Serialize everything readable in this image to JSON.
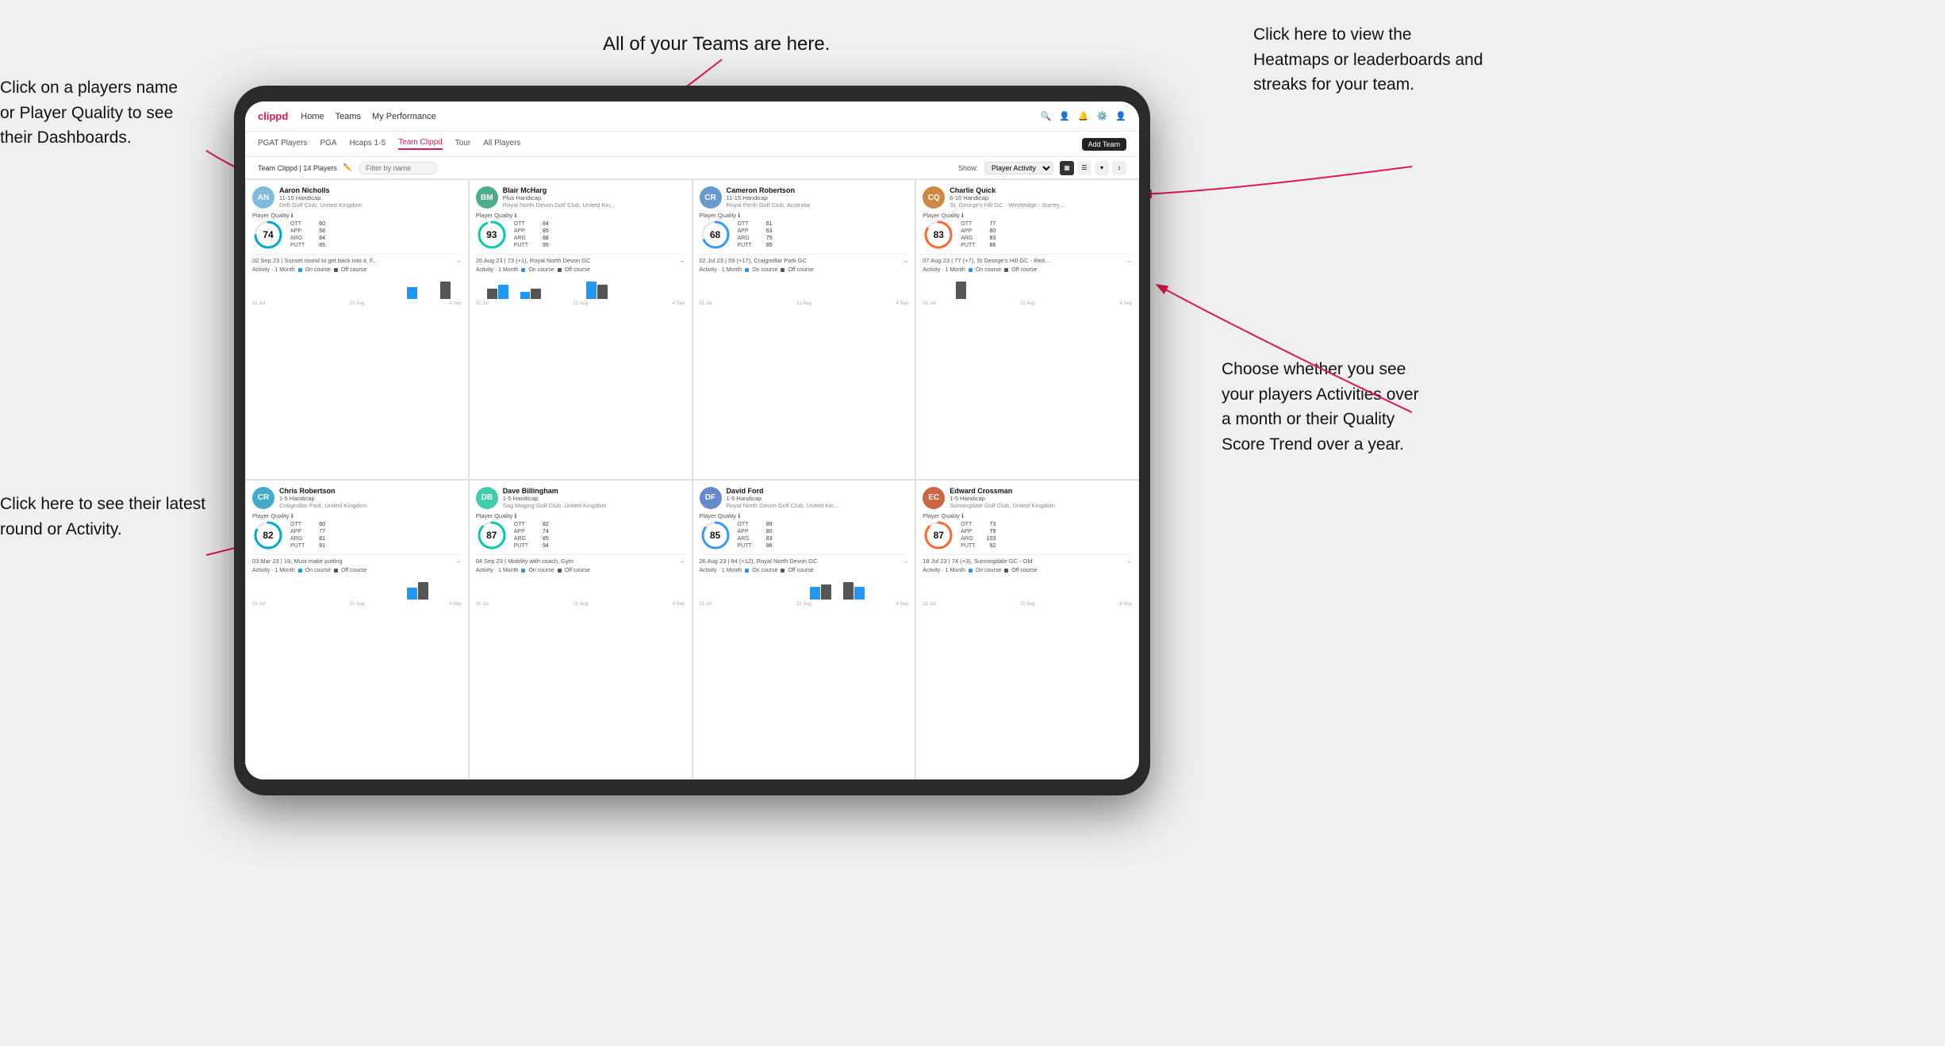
{
  "annotations": {
    "top_left": "Click on a players name\nor Player Quality to see\ntheir Dashboards.",
    "bottom_left": "Click here to see their latest\nround or Activity.",
    "top_center": "All of your Teams are here.",
    "top_right_1": "Click here to view the\nHeatmaps or leaderboards\nand streaks for your team.",
    "bottom_right": "Choose whether you see\nyour players Activities over\na month or their Quality\nScore Trend over a year."
  },
  "navbar": {
    "brand": "clippd",
    "items": [
      "Home",
      "Teams",
      "My Performance"
    ]
  },
  "tabs": {
    "items": [
      "PGAT Players",
      "PGA",
      "Hcaps 1-5",
      "Team Clippd",
      "Tour",
      "All Players"
    ],
    "active": "Team Clippd",
    "add_btn": "Add Team"
  },
  "toolbar": {
    "title": "Team Clippd | 14 Players",
    "filter_placeholder": "Filter by name",
    "show_label": "Show:",
    "show_value": "Player Activity"
  },
  "players": [
    {
      "name": "Aaron Nicholls",
      "handicap": "11-15 Handicap",
      "club": "Drift Golf Club, United Kingdom",
      "quality": 74,
      "color": "#00aacc",
      "stats": [
        {
          "label": "OTT",
          "color": "#f5a623",
          "val": 60,
          "pct": 60
        },
        {
          "label": "APP",
          "color": "#7ed321",
          "val": 58,
          "pct": 58
        },
        {
          "label": "ARG",
          "color": "#e0184d",
          "val": 84,
          "pct": 84
        },
        {
          "label": "PUTT",
          "color": "#9b59b6",
          "val": 85,
          "pct": 85
        }
      ],
      "round": "02 Sep 23 | Sunset round to get back into it, F...",
      "chart_bars": [
        0,
        0,
        0,
        0,
        0,
        0,
        0,
        0,
        0,
        0,
        0,
        0,
        0,
        0,
        2,
        0,
        0,
        3,
        0
      ],
      "chart_labels": [
        "31 Jul",
        "21 Aug",
        "4 Sep"
      ]
    },
    {
      "name": "Blair McHarg",
      "handicap": "Plus Handicap",
      "club": "Royal North Devon Golf Club, United Kin...",
      "quality": 93,
      "color": "#00ccaa",
      "stats": [
        {
          "label": "OTT",
          "color": "#f5a623",
          "val": 84,
          "pct": 84
        },
        {
          "label": "APP",
          "color": "#7ed321",
          "val": 85,
          "pct": 85
        },
        {
          "label": "ARG",
          "color": "#e0184d",
          "val": 88,
          "pct": 88
        },
        {
          "label": "PUTT",
          "color": "#9b59b6",
          "val": 95,
          "pct": 95
        }
      ],
      "round": "26 Aug 23 | 73 (+1), Royal North Devon GC",
      "chart_bars": [
        0,
        3,
        4,
        0,
        2,
        3,
        0,
        0,
        0,
        0,
        5,
        4,
        0,
        0,
        0,
        0,
        0,
        0,
        0
      ],
      "chart_labels": [
        "31 Jul",
        "21 Aug",
        "4 Sep"
      ]
    },
    {
      "name": "Cameron Robertson",
      "handicap": "11-15 Handicap",
      "club": "Royal Perth Golf Club, Australia",
      "quality": 68,
      "color": "#3399ff",
      "stats": [
        {
          "label": "OTT",
          "color": "#f5a623",
          "val": 61,
          "pct": 61
        },
        {
          "label": "APP",
          "color": "#7ed321",
          "val": 63,
          "pct": 63
        },
        {
          "label": "ARG",
          "color": "#e0184d",
          "val": 75,
          "pct": 75
        },
        {
          "label": "PUTT",
          "color": "#9b59b6",
          "val": 85,
          "pct": 85
        }
      ],
      "round": "02 Jul 23 | 59 (+17), Craigmillar Park GC",
      "chart_bars": [
        0,
        0,
        0,
        0,
        0,
        0,
        0,
        0,
        0,
        0,
        0,
        0,
        0,
        0,
        0,
        0,
        0,
        0,
        0
      ],
      "chart_labels": [
        "31 Jul",
        "21 Aug",
        "4 Sep"
      ]
    },
    {
      "name": "Charlie Quick",
      "handicap": "6-10 Handicap",
      "club": "St. George's Hill GC - Weybridge - Surrey...",
      "quality": 83,
      "color": "#ff6633",
      "stats": [
        {
          "label": "OTT",
          "color": "#f5a623",
          "val": 77,
          "pct": 77
        },
        {
          "label": "APP",
          "color": "#7ed321",
          "val": 80,
          "pct": 80
        },
        {
          "label": "ARG",
          "color": "#e0184d",
          "val": 83,
          "pct": 83
        },
        {
          "label": "PUTT",
          "color": "#9b59b6",
          "val": 86,
          "pct": 86
        }
      ],
      "round": "07 Aug 23 | 77 (+7), St George's Hill GC - Red...",
      "chart_bars": [
        0,
        0,
        0,
        2,
        0,
        0,
        0,
        0,
        0,
        0,
        0,
        0,
        0,
        0,
        0,
        0,
        0,
        0,
        0
      ],
      "chart_labels": [
        "31 Jul",
        "21 Aug",
        "4 Sep"
      ]
    },
    {
      "name": "Chris Robertson",
      "handicap": "1-5 Handicap",
      "club": "Craigmillar Park, United Kingdom",
      "quality": 82,
      "color": "#00aacc",
      "stats": [
        {
          "label": "OTT",
          "color": "#f5a623",
          "val": 60,
          "pct": 60
        },
        {
          "label": "APP",
          "color": "#7ed321",
          "val": 77,
          "pct": 77
        },
        {
          "label": "ARG",
          "color": "#e0184d",
          "val": 81,
          "pct": 81
        },
        {
          "label": "PUTT",
          "color": "#9b59b6",
          "val": 91,
          "pct": 91
        }
      ],
      "round": "03 Mar 23 | 19, Must make putting",
      "chart_bars": [
        0,
        0,
        0,
        0,
        0,
        0,
        0,
        0,
        0,
        0,
        0,
        0,
        0,
        0,
        2,
        3,
        0,
        0,
        0
      ],
      "chart_labels": [
        "31 Jul",
        "21 Aug",
        "4 Sep"
      ]
    },
    {
      "name": "Dave Billingham",
      "handicap": "1-5 Handicap",
      "club": "Sag Maging Golf Club, United Kingdom",
      "quality": 87,
      "color": "#00ccaa",
      "stats": [
        {
          "label": "OTT",
          "color": "#f5a623",
          "val": 82,
          "pct": 82
        },
        {
          "label": "APP",
          "color": "#7ed321",
          "val": 74,
          "pct": 74
        },
        {
          "label": "ARG",
          "color": "#e0184d",
          "val": 85,
          "pct": 85
        },
        {
          "label": "PUTT",
          "color": "#9b59b6",
          "val": 94,
          "pct": 94
        }
      ],
      "round": "04 Sep 23 | Mobility with coach, Gym",
      "chart_bars": [
        0,
        0,
        0,
        0,
        0,
        0,
        0,
        0,
        0,
        0,
        0,
        0,
        0,
        0,
        0,
        0,
        0,
        0,
        0
      ],
      "chart_labels": [
        "31 Jul",
        "21 Aug",
        "4 Sep"
      ]
    },
    {
      "name": "David Ford",
      "handicap": "1-5 Handicap",
      "club": "Royal North Devon Golf Club, United Kin...",
      "quality": 85,
      "color": "#3399ff",
      "stats": [
        {
          "label": "OTT",
          "color": "#f5a623",
          "val": 89,
          "pct": 89
        },
        {
          "label": "APP",
          "color": "#7ed321",
          "val": 80,
          "pct": 80
        },
        {
          "label": "ARG",
          "color": "#e0184d",
          "val": 83,
          "pct": 83
        },
        {
          "label": "PUTT",
          "color": "#9b59b6",
          "val": 96,
          "pct": 96
        }
      ],
      "round": "26 Aug 23 | 84 (+12), Royal North Devon GC",
      "chart_bars": [
        0,
        0,
        0,
        0,
        0,
        0,
        0,
        0,
        0,
        0,
        5,
        6,
        0,
        7,
        5,
        0,
        0,
        0,
        0
      ],
      "chart_labels": [
        "31 Jul",
        "21 Aug",
        "4 Sep"
      ]
    },
    {
      "name": "Edward Crossman",
      "handicap": "1-5 Handicap",
      "club": "Sunningdale Golf Club, United Kingdom",
      "quality": 87,
      "color": "#ff6633",
      "stats": [
        {
          "label": "OTT",
          "color": "#f5a623",
          "val": 73,
          "pct": 73
        },
        {
          "label": "APP",
          "color": "#7ed321",
          "val": 79,
          "pct": 79
        },
        {
          "label": "ARG",
          "color": "#e0184d",
          "val": 103,
          "pct": 100
        },
        {
          "label": "PUTT",
          "color": "#9b59b6",
          "val": 92,
          "pct": 92
        }
      ],
      "round": "18 Jul 23 | 74 (+3), Sunningdale GC - Old",
      "chart_bars": [
        0,
        0,
        0,
        0,
        0,
        0,
        0,
        0,
        0,
        0,
        0,
        0,
        0,
        0,
        0,
        0,
        0,
        0,
        0
      ],
      "chart_labels": [
        "31 Jul",
        "21 Aug",
        "4 Sep"
      ]
    }
  ]
}
